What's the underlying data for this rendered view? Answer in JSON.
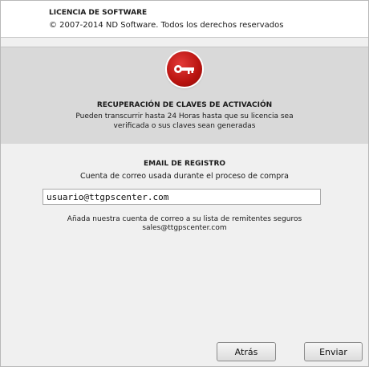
{
  "header": {
    "title": "LICENCIA DE SOFTWARE",
    "copyright": "© 2007-2014 ND Software. Todos los derechos reservados"
  },
  "activation": {
    "icon": "key-icon",
    "badge_color": "#c0201c",
    "title": "RECUPERACIÓN DE CLAVES DE ACTIVACIÓN",
    "desc_line1": "Pueden transcurrir hasta 24 Horas hasta que su licencia sea",
    "desc_line2": "verificada o sus claves sean generadas"
  },
  "email": {
    "title": "EMAIL DE REGISTRO",
    "description": "Cuenta de correo usada durante el proceso de compra",
    "value": "usuario@ttgpscenter.com",
    "safe_line1": "Añada nuestra cuenta de correo a su lista de remitentes seguros",
    "safe_line2": "sales@ttgpscenter.com"
  },
  "buttons": {
    "back_label": "Atrás",
    "send_label": "Enviar"
  }
}
